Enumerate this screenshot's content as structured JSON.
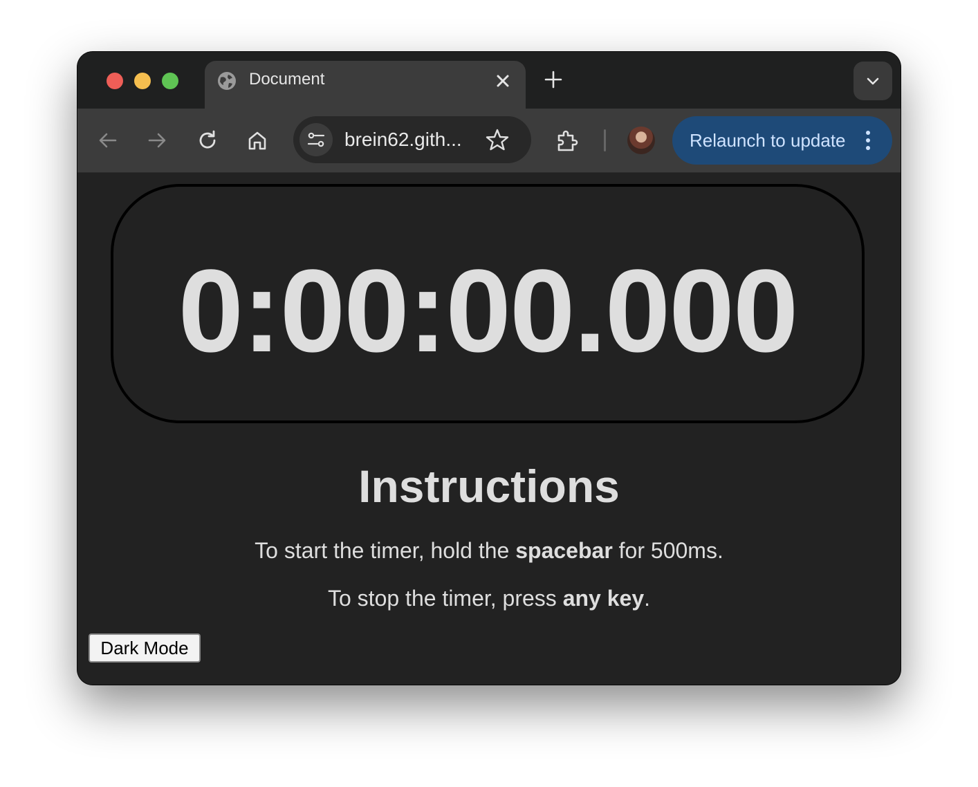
{
  "browser": {
    "tab": {
      "title": "Document"
    },
    "address_bar": {
      "url": "brein62.gith..."
    },
    "relaunch_button": {
      "label": "Relaunch to update"
    },
    "colors": {
      "accent": "#1e4a78",
      "accent_text": "#cfe3ff"
    }
  },
  "page": {
    "timer": {
      "display": "0:00:00.000"
    },
    "instructions": {
      "title": "Instructions",
      "line1": {
        "before": "To start the timer, hold the ",
        "bold": "spacebar",
        "after": " for 500ms."
      },
      "line2": {
        "before": "To stop the timer, press ",
        "bold": "any key",
        "after": "."
      }
    },
    "dark_mode_button": {
      "label": "Dark Mode"
    }
  }
}
